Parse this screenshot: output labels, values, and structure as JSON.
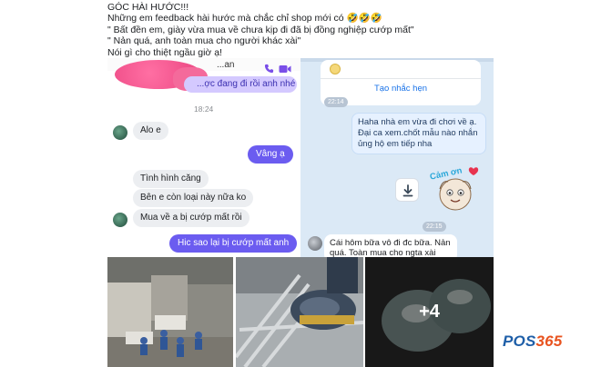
{
  "caption": {
    "lines": [
      "GÓC HÀI HƯỚC!!!",
      "Những em feedback hài hước mà chắc chỉ shop mới có 🤣🤣🤣",
      "\" Bất đền em, giày vừa mua về chưa kịp đi đã bị đồng nghiệp cướp mất\"",
      "\" Nản quá, anh toàn mua cho người khác xài\"",
      "Nói gì cho thiệt ngầu giờ ạ!"
    ]
  },
  "left_chat": {
    "header_name": "...an",
    "top_bubble": "...ợc đang đi rồi anh nhé",
    "time": "18:24",
    "messages": [
      {
        "dir": "in",
        "text": "Alo e"
      },
      {
        "dir": "out",
        "text": "Vâng ạ"
      },
      {
        "dir": "in",
        "text": "Tình hình căng"
      },
      {
        "dir": "in",
        "text": "Bên e còn loại này nữa ko"
      },
      {
        "dir": "in",
        "text": "Mua về a bị cướp mất rồi"
      },
      {
        "dir": "out",
        "text": "Hic sao lại bị cướp mất anh"
      }
    ],
    "icons": [
      "phone-icon",
      "video-icon"
    ]
  },
  "right_chat": {
    "card_time": "22:14",
    "card_link": "Tạo nhắc hẹn",
    "message": "Haha nhà em vừa đi chơi về ạ. Đại ca xem.chốt mẫu nào nhắn ủng hộ em tiếp nha",
    "sticker_text": "Cảm ơn",
    "sticker_time": "22:15",
    "reply": "Cái hôm bữa vô đi đc bữa. Nản quá. Toàn mua cho ngta xài",
    "icons": [
      "download-icon"
    ]
  },
  "photos": {
    "more_count": "+4",
    "items": [
      "warehouse-workers-photo",
      "shoe-on-foot-photo",
      "shoes-closeup-photo"
    ]
  },
  "logo": {
    "part_a": "POS",
    "part_b": "365"
  },
  "colors": {
    "out_bubble": "#6b5cf0",
    "right_bg": "#dbe9f6",
    "link": "#1a73e8",
    "logo_blue": "#1f5fa8",
    "logo_orange": "#e8531f"
  }
}
